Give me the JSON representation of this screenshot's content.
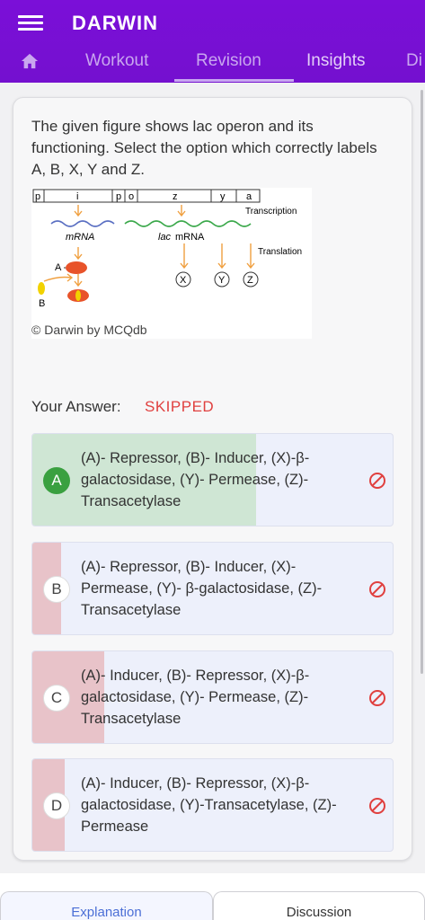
{
  "app": {
    "title": "DARWIN"
  },
  "tabs": [
    {
      "label": "Workout"
    },
    {
      "label": "Revision"
    },
    {
      "label": "Insights"
    },
    {
      "label": "Di"
    }
  ],
  "question": {
    "text": "The given figure shows lac operon and its functioning. Select the option which correctly labels A, B, X, Y and Z."
  },
  "figure": {
    "gene_labels": [
      "p",
      "i",
      "p",
      "o",
      "z",
      "y",
      "a"
    ],
    "transcription_label": "Transcription",
    "translation_label": "Translation",
    "mrna_label": "mRNA",
    "lac_mrna_prefix": "lac",
    "lac_mrna_suffix": "mRNA",
    "label_a": "A",
    "label_b": "B",
    "label_x": "X",
    "label_y": "Y",
    "label_z": "Z",
    "watermark": "© Darwin by MCQdb"
  },
  "answer": {
    "label": "Your Answer:",
    "value": "SKIPPED"
  },
  "options": [
    {
      "letter": "A",
      "text": "(A)- Repressor, (B)- Inducer, (X)-β-galactosidase, (Y)- Permease, (Z)-Transacetylase",
      "percent": 62,
      "correct": true
    },
    {
      "letter": "B",
      "text": "(A)- Repressor, (B)- Inducer, (X)-Permease, (Y)- β-galactosidase, (Z)- Transacetylase",
      "percent": 8,
      "correct": false
    },
    {
      "letter": "C",
      "text": "(A)- Inducer, (B)- Repressor, (X)-β-galactosidase, (Y)- Permease, (Z)- Transacetylase",
      "percent": 20,
      "correct": false
    },
    {
      "letter": "D",
      "text": "(A)- Inducer, (B)- Repressor, (X)-β-galactosidase, (Y)-Transacetylase, (Z)- Permease",
      "percent": 9,
      "correct": false
    }
  ],
  "bottom_tabs": {
    "explanation": "Explanation",
    "discussion": "Discussion"
  },
  "colors": {
    "primary": "#7a0fd6",
    "correct": "#3aa040",
    "wrong_fill": "#e8c3c9",
    "correct_fill": "#cfe6d4",
    "skipped": "#e0403f",
    "link": "#4b6fd6"
  }
}
